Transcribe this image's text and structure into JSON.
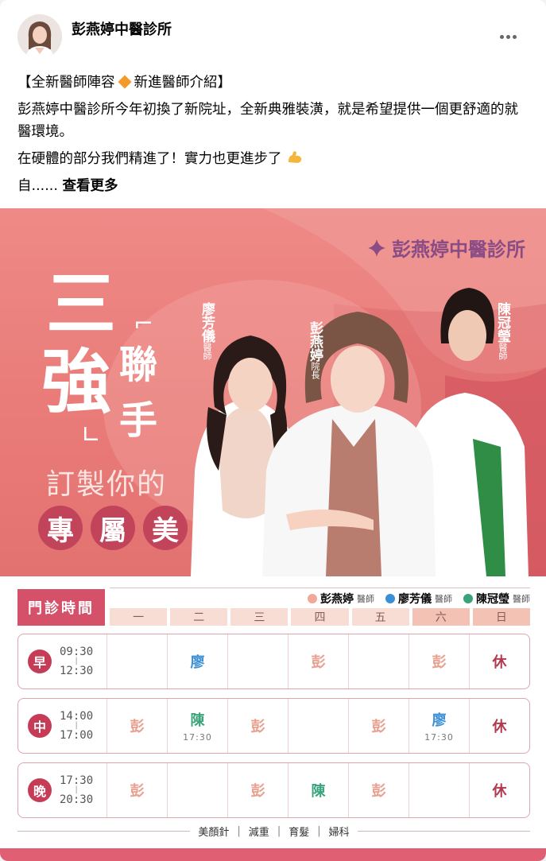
{
  "post": {
    "page_name": "彭燕婷中醫診所",
    "more_label": "更多選項",
    "line1_a": "【全新醫師陣容",
    "line1_b": "新進醫師介紹】",
    "line2": "彭燕婷中醫診所今年初換了新院址，全新典雅裝潢，就是希望提供一個更舒適的就醫環境。",
    "line3": "在硬體的部分我們精進了！實力也更進步了",
    "line4_prefix": "自......",
    "see_more": "查看更多"
  },
  "banner": {
    "brand": "彭燕婷中醫診所",
    "title_san": "三",
    "title_qiang": "強",
    "title_lian": "聯",
    "title_shou": "手",
    "slogan": "訂製你的",
    "slogan_chars": [
      "專",
      "屬",
      "美"
    ],
    "doctors": [
      {
        "name": "廖芳儀",
        "title": "醫師"
      },
      {
        "name": "彭燕婷",
        "title": "院長"
      },
      {
        "name": "陳冠瑩",
        "title": "醫師"
      }
    ]
  },
  "schedule": {
    "title": "門診時間",
    "legend": [
      {
        "name": "彭燕婷",
        "suffix": "醫師",
        "color": "#f2a896"
      },
      {
        "name": "廖芳儀",
        "suffix": "醫師",
        "color": "#3b8fd5"
      },
      {
        "name": "陳冠瑩",
        "suffix": "醫師",
        "color": "#3aa37b"
      }
    ],
    "days": [
      "一",
      "二",
      "三",
      "四",
      "五",
      "六",
      "日"
    ],
    "slots": [
      {
        "badge": "早",
        "start": "09:30",
        "sep": "|",
        "end": "12:30",
        "cells": [
          {
            "t": ""
          },
          {
            "t": "廖"
          },
          {
            "t": ""
          },
          {
            "t": "彭"
          },
          {
            "t": ""
          },
          {
            "t": "彭"
          },
          {
            "t": "休"
          }
        ]
      },
      {
        "badge": "中",
        "start": "14:00",
        "sep": "|",
        "end": "17:00",
        "cells": [
          {
            "t": "彭"
          },
          {
            "t": "陳",
            "note": "17:30"
          },
          {
            "t": "彭"
          },
          {
            "t": ""
          },
          {
            "t": "彭"
          },
          {
            "t": "廖",
            "note": "17:30"
          },
          {
            "t": "休"
          }
        ]
      },
      {
        "badge": "晚",
        "start": "17:30",
        "sep": "|",
        "end": "20:30",
        "cells": [
          {
            "t": "彭"
          },
          {
            "t": ""
          },
          {
            "t": "彭"
          },
          {
            "t": "陳"
          },
          {
            "t": "彭"
          },
          {
            "t": ""
          },
          {
            "t": "休"
          }
        ]
      }
    ],
    "services": [
      "美顏針",
      "減重",
      "育髮",
      "婦科"
    ],
    "service_sep": "|"
  }
}
